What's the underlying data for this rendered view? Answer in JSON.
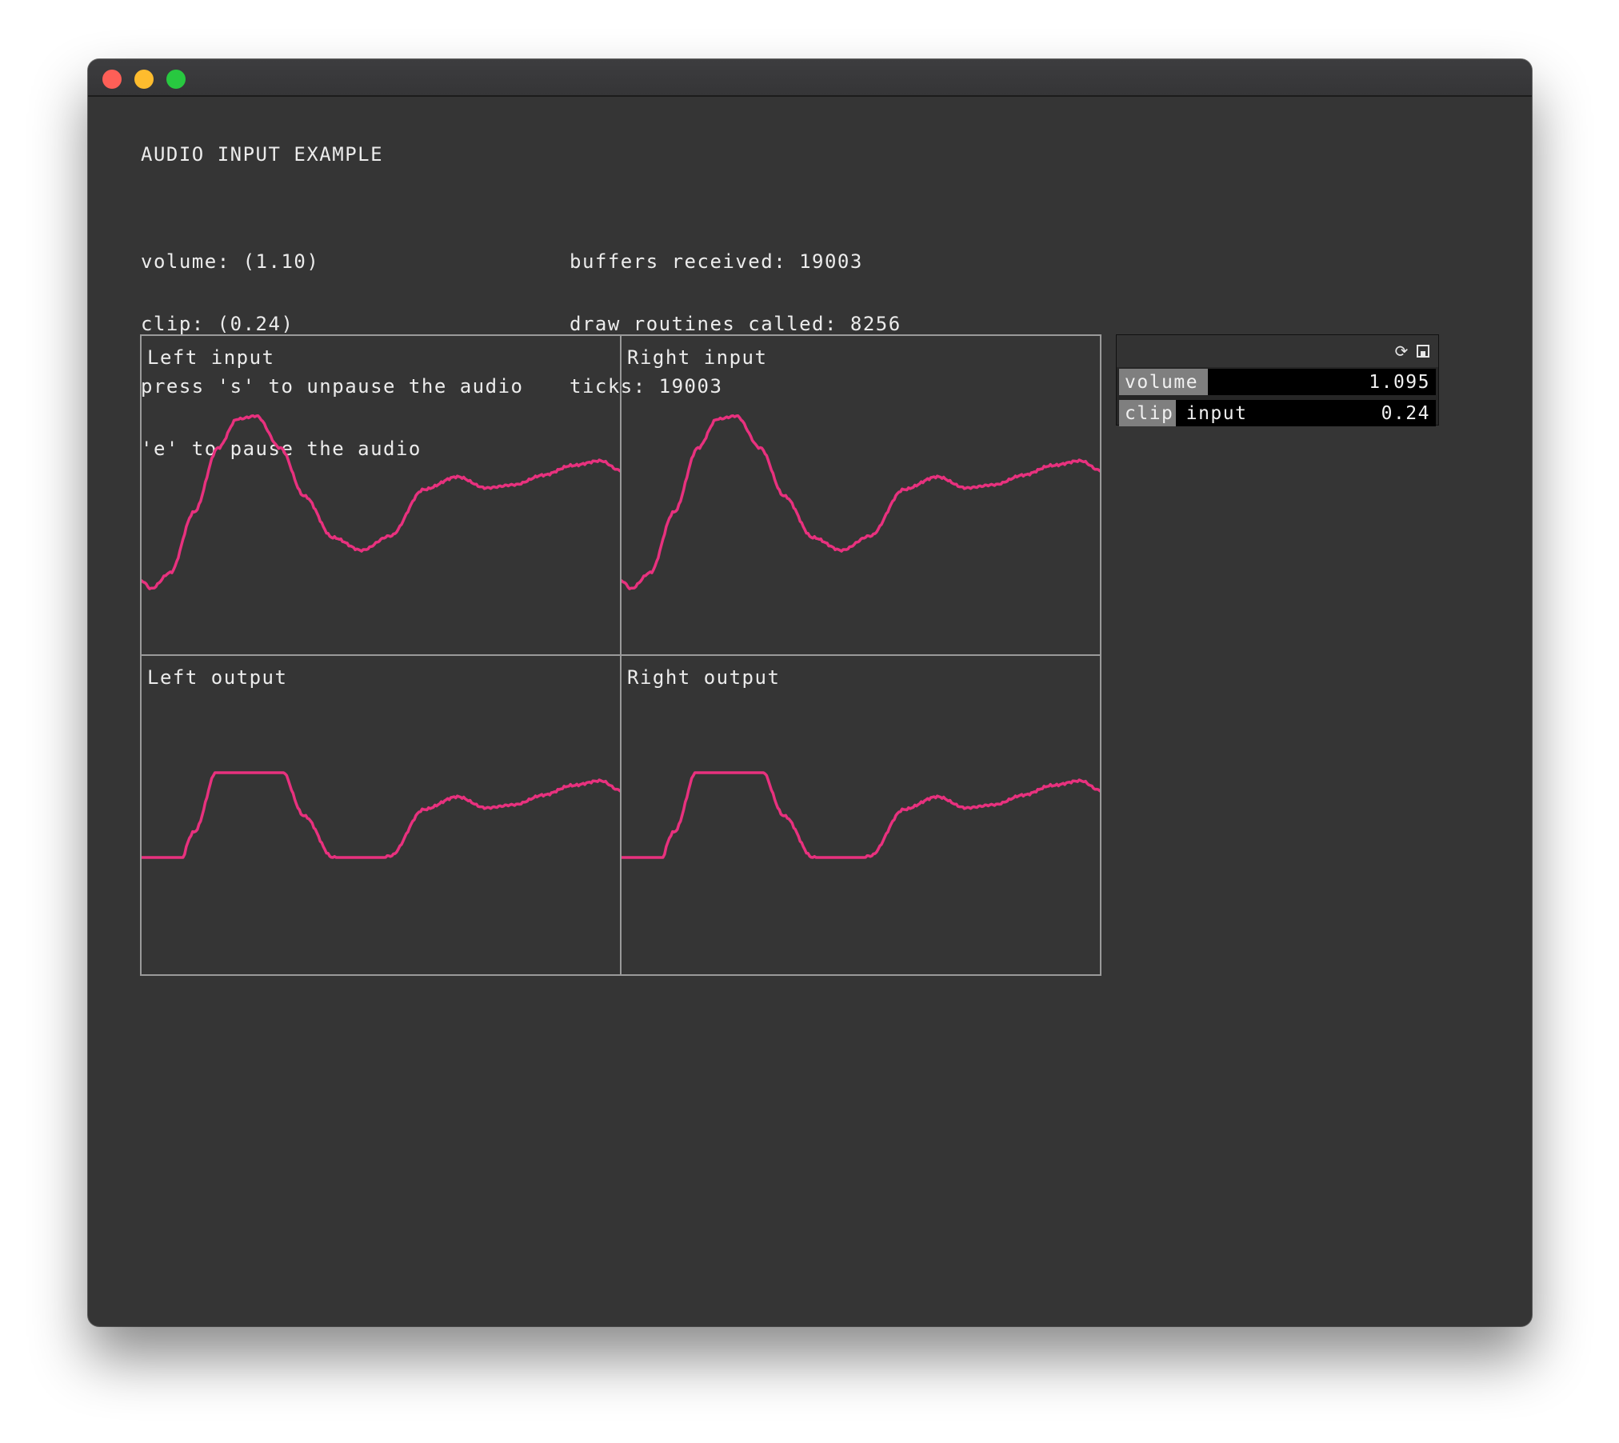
{
  "window": {
    "controls": [
      "close",
      "minimize",
      "zoom"
    ]
  },
  "app": {
    "title": "AUDIO INPUT EXAMPLE",
    "info_left": [
      "volume: (1.10)",
      "clip: (0.24)",
      "press 's' to unpause the audio",
      "'e' to pause the audio"
    ],
    "info_right": [
      "buffers received: 19003",
      "draw routines called: 8256",
      "ticks: 19003"
    ]
  },
  "scopes": [
    {
      "label": "Left input"
    },
    {
      "label": "Right input"
    },
    {
      "label": "Left output"
    },
    {
      "label": "Right output"
    }
  ],
  "gui": {
    "icons": [
      "reload-icon",
      "save-icon"
    ],
    "sliders": [
      {
        "label": "volume",
        "value": "1.095",
        "fill_fraction": 0.28
      },
      {
        "label": "clip input",
        "value": "0.24",
        "fill_fraction": 0.18
      }
    ]
  },
  "colors": {
    "background": "#353535",
    "waveform": "#e8317e",
    "text": "#ececec",
    "scope_border": "#9a9a9a",
    "slider_fill": "#7f7f7f",
    "slider_bg": "#000000"
  }
}
